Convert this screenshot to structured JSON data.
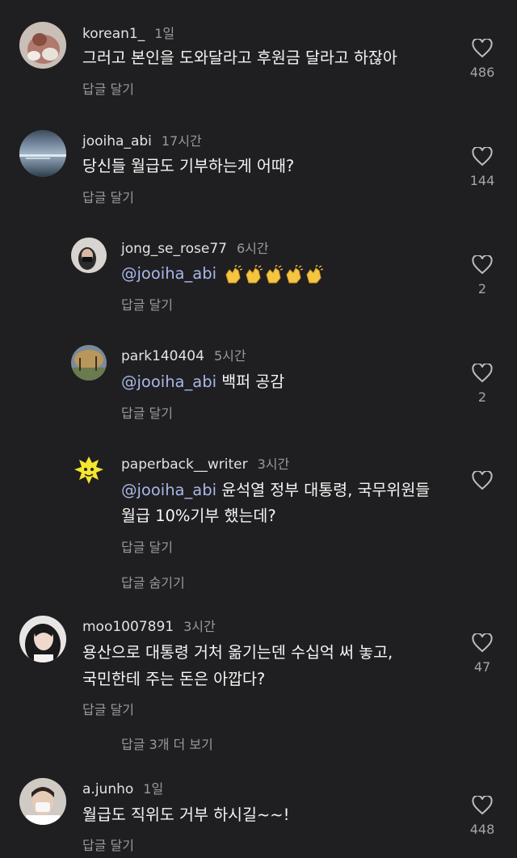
{
  "comments": [
    {
      "username": "korean1_",
      "time": "1일",
      "text": "그러고 본인을 도와달라고 후원금 달라고 하잖아",
      "reply_label": "답글 달기",
      "likes": "486"
    },
    {
      "username": "jooiha_abi",
      "time": "17시간",
      "text": "당신들 월급도 기부하는게 어때?",
      "reply_label": "답글 달기",
      "likes": "144",
      "replies": [
        {
          "username": "jong_se_rose77",
          "time": "6시간",
          "mention": "@jooiha_abi",
          "emoji": "clapping-hands x5",
          "reply_label": "답글 달기",
          "likes": "2"
        },
        {
          "username": "park140404",
          "time": "5시간",
          "mention": "@jooiha_abi",
          "text": "백퍼 공감",
          "reply_label": "답글 달기",
          "likes": "2"
        },
        {
          "username": "paperback__writer",
          "time": "3시간",
          "mention": "@jooiha_abi",
          "text_line1": "윤석열 정부 대통령, 국무위원들",
          "text_line2": "월급 10%기부 했는데?",
          "reply_label": "답글 달기",
          "likes": ""
        }
      ],
      "hide_replies_label": "답글 숨기기"
    },
    {
      "username": "moo1007891",
      "time": "3시간",
      "text_line1": "용산으로 대통령 거처 옮기는덴 수십억 써 놓고,",
      "text_line2": "국민한테 주는 돈은 아깝다?",
      "reply_label": "답글 달기",
      "likes": "47",
      "more_replies_label": "답글 3개 더 보기"
    },
    {
      "username": "a.junho",
      "time": "1일",
      "text": "월급도 직위도 거부 하시길~~!",
      "reply_label": "답글 달기",
      "likes": "448"
    }
  ],
  "colors": {
    "background": "#1f1f21",
    "mention": "#a9b6e8",
    "secondary_text": "#9a9a9a"
  },
  "icons": {
    "like": "heart-outline-icon"
  }
}
